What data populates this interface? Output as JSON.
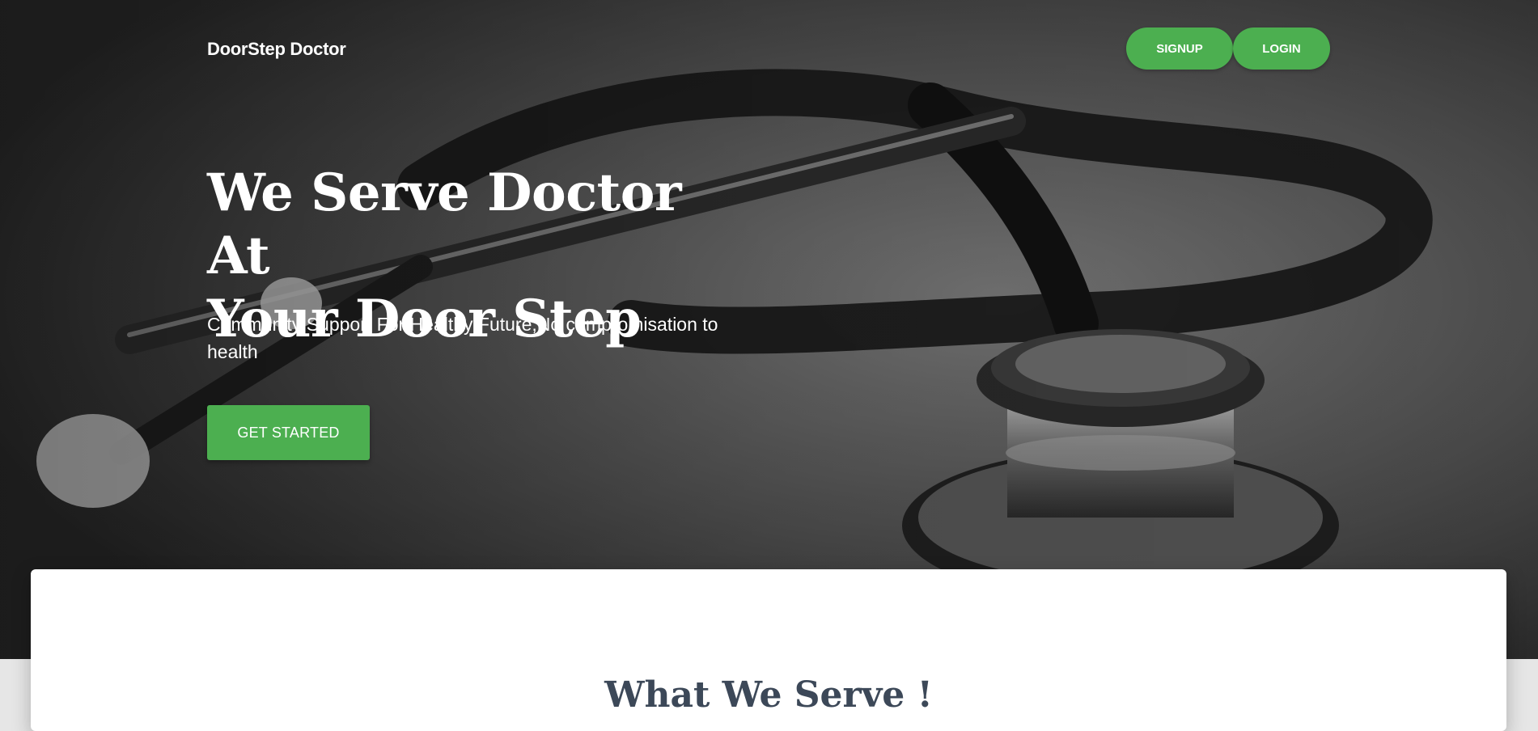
{
  "navbar": {
    "brand": "DoorStep Doctor",
    "signup_label": "SIGNUP",
    "login_label": "LOGIN"
  },
  "hero": {
    "title_line1": "We Serve Doctor At",
    "title_line2": "Your Door Step",
    "subtitle": "Community Support For Healthy Future,No compromisation to health",
    "cta_label": "GET STARTED",
    "background_image": "stethoscope-photo"
  },
  "section": {
    "title": "What We Serve !"
  },
  "colors": {
    "accent": "#4caf50",
    "heading_dark": "#3c4858",
    "hero_text": "#ffffff"
  }
}
